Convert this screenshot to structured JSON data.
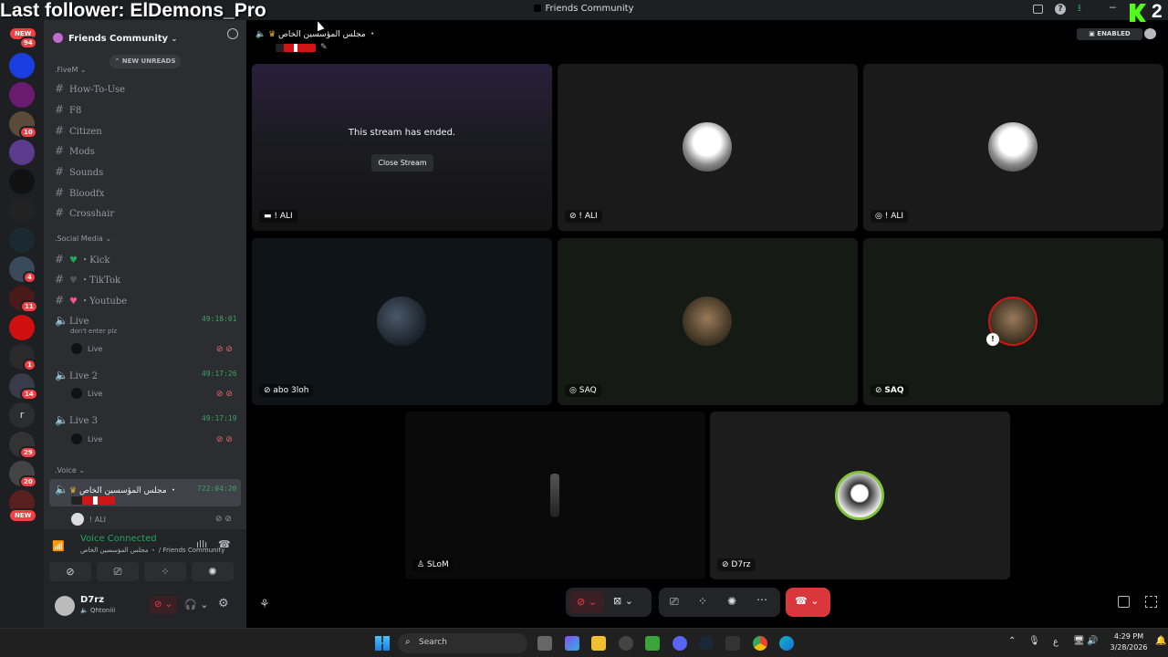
{
  "overlay": {
    "follower_text": "Last follower: ElDemons_Pro",
    "corner_number": "2"
  },
  "window": {
    "title": "Friends Community"
  },
  "server_list": {
    "badges": [
      "NEW",
      "94",
      "10",
      "4",
      "11",
      "1",
      "14",
      "29",
      "20",
      "NEW"
    ],
    "letter": "r"
  },
  "sidebar": {
    "server_name": "Friends Community",
    "new_unreads": "NEW UNREADS",
    "categories": {
      "fivem": ".FiveM",
      "social": ".Social Media",
      "voice": ".Voice"
    },
    "text_channels": [
      "How-To-Use",
      "F8",
      "Citizen",
      "Mods",
      "Sounds",
      "Bloodfx",
      "Crosshair"
    ],
    "social_channels": [
      "・Kick",
      "・TikTok",
      "・Youtube"
    ],
    "voice_channels": [
      {
        "name": "Live",
        "time": "49:18:01",
        "topic": "don't enter plz",
        "member": "Live"
      },
      {
        "name": "Live 2",
        "time": "49:17:26",
        "member": "Live"
      },
      {
        "name": "Live 3",
        "time": "49:17:19",
        "member": "Live"
      }
    ],
    "active_voice": {
      "name": "مجلس المؤسسين الخاص ・",
      "time": "722:04:20",
      "member": "! ALI"
    }
  },
  "voice_panel": {
    "status": "Voice Connected",
    "location": "مجلس المؤسسين الخاص ・ / Friends Community"
  },
  "user_panel": {
    "username": "D7rz",
    "status": "Qhtoniii"
  },
  "header": {
    "channel": "مجلس المؤسسين الخاص ・",
    "enabled": "ENABLED"
  },
  "stream": {
    "ended_text": "This stream has ended.",
    "close_button": "Close Stream"
  },
  "tiles": [
    {
      "label": "! ALI"
    },
    {
      "label": "! ALI"
    },
    {
      "label": "! ALI"
    },
    {
      "label": "abo 3loh"
    },
    {
      "label": "SAQ"
    },
    {
      "label": "SAQ"
    },
    {
      "label": "SLoM"
    },
    {
      "label": "D7rz"
    }
  ],
  "taskbar": {
    "search": "Search",
    "time": "4:29 PM",
    "date": "3/28/2026",
    "lang": "ع"
  },
  "colors": {
    "accent": "#5865f2",
    "green": "#23a55a",
    "red": "#da373c",
    "bg": "#2b2d31"
  }
}
